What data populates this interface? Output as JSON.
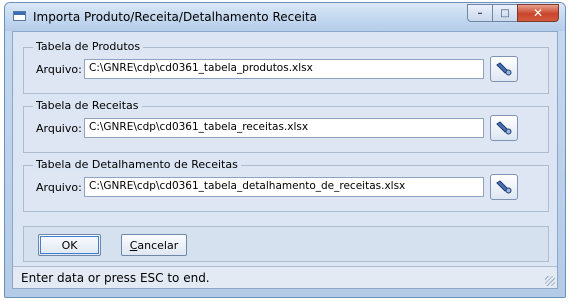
{
  "window": {
    "title": "Importa Produto/Receita/Detalhamento Receita",
    "controls": {
      "minimize": "–",
      "maximize": "□",
      "close": "✕"
    }
  },
  "groups": [
    {
      "title": "Tabela de Produtos",
      "label": "Arquivo:",
      "value": "C:\\GNRE\\cdp\\cd0361_tabela_produtos.xlsx"
    },
    {
      "title": "Tabela de Receitas",
      "label": "Arquivo:",
      "value": "C:\\GNRE\\cdp\\cd0361_tabela_receitas.xlsx"
    },
    {
      "title": "Tabela de Detalhamento de Receitas",
      "label": "Arquivo:",
      "value": "C:\\GNRE\\cdp\\cd0361_tabela_detalhamento_de_receitas.xlsx"
    }
  ],
  "buttons": {
    "ok": "OK",
    "cancel": "Cancelar"
  },
  "status": "Enter data or press ESC to end."
}
